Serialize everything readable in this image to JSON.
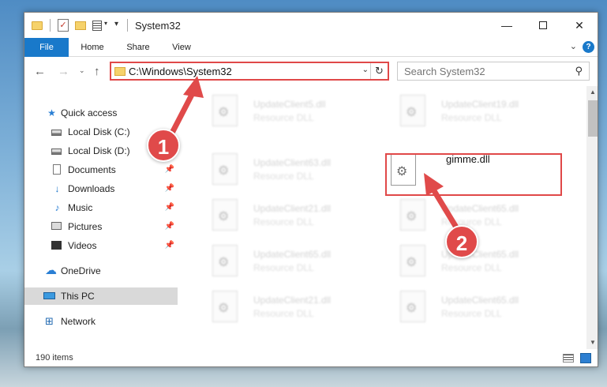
{
  "window": {
    "title": "System32",
    "controls": {
      "minimize": "—",
      "maximize": "",
      "close": "✕"
    }
  },
  "ribbon": {
    "tabs": [
      "File",
      "Home",
      "Share",
      "View"
    ],
    "expand": "⌄",
    "help": "?"
  },
  "address": {
    "path": "C:\\Windows\\System32",
    "dropdown": "⌄",
    "refresh": "↻"
  },
  "search": {
    "placeholder": "Search System32"
  },
  "nav": {
    "back": "←",
    "forward": "→",
    "recent": "⌄",
    "up": "↑"
  },
  "sidebar": {
    "items": [
      {
        "label": "Quick access",
        "icon": "star-icon"
      },
      {
        "label": "Local Disk (C:)",
        "icon": "drive-icon"
      },
      {
        "label": "Local Disk (D:)",
        "icon": "drive-icon"
      },
      {
        "label": "Documents",
        "icon": "document-icon",
        "pinned": true
      },
      {
        "label": "Downloads",
        "icon": "download-icon",
        "pinned": true
      },
      {
        "label": "Music",
        "icon": "music-icon",
        "pinned": true
      },
      {
        "label": "Pictures",
        "icon": "pictures-icon",
        "pinned": true
      },
      {
        "label": "Videos",
        "icon": "video-icon",
        "pinned": true
      },
      {
        "label": "OneDrive",
        "icon": "cloud-icon"
      },
      {
        "label": "This PC",
        "icon": "computer-icon",
        "selected": true
      },
      {
        "label": "Network",
        "icon": "network-icon"
      }
    ],
    "pin": "📌"
  },
  "files": {
    "left": [
      {
        "name": "UpdateClient5.dll",
        "type": "Resource DLL"
      },
      {
        "name": "UpdateClient63.dll",
        "type": "Resource DLL"
      },
      {
        "name": "UpdateClient21.dll",
        "type": "Resource DLL"
      },
      {
        "name": "UpdateClient65.dll",
        "type": "Resource DLL"
      },
      {
        "name": "UpdateClient21.dll",
        "type": "Resource DLL"
      }
    ],
    "right": [
      {
        "name": "UpdateClient19.dll",
        "type": "Resource DLL"
      },
      {
        "name": "gimme.dll",
        "type": ""
      },
      {
        "name": "UpdateClient65.dll",
        "type": "Resource DLL"
      },
      {
        "name": "UpdateClient65.dll",
        "type": "Resource DLL"
      },
      {
        "name": "UpdateClient65.dll",
        "type": "Resource DLL"
      }
    ]
  },
  "status": {
    "count": "190 items"
  },
  "annotations": {
    "step1": "1",
    "step2": "2",
    "color": "#e04a4a"
  },
  "colors": {
    "accent": "#1979ca",
    "highlight": "#e04848"
  }
}
